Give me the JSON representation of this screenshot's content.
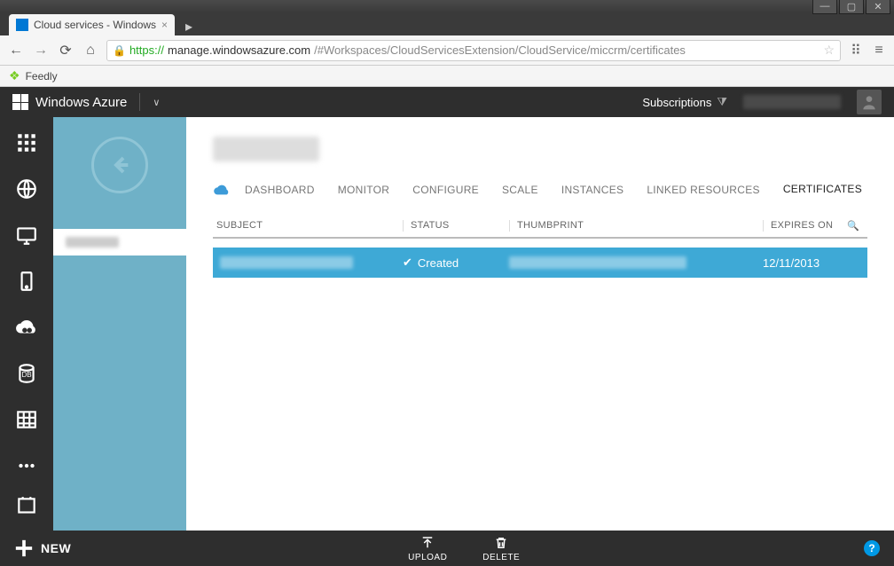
{
  "browser": {
    "tab_title": "Cloud services - Windows",
    "bookmark": "Feedly",
    "url_proto": "https://",
    "url_host": "manage.windowsazure.com",
    "url_path": "/#Workspaces/CloudServicesExtension/CloudService/miccrm/certificates"
  },
  "header": {
    "brand": "Windows Azure",
    "subscriptions_label": "Subscriptions"
  },
  "tabs": {
    "dashboard": "DASHBOARD",
    "monitor": "MONITOR",
    "configure": "CONFIGURE",
    "scale": "SCALE",
    "instances": "INSTANCES",
    "linked": "LINKED RESOURCES",
    "certificates": "CERTIFICATES"
  },
  "table": {
    "headers": {
      "subject": "SUBJECT",
      "status": "STATUS",
      "thumbprint": "THUMBPRINT",
      "expires": "EXPIRES ON"
    },
    "row": {
      "status": "Created",
      "expires": "12/11/2013"
    }
  },
  "commands": {
    "new": "NEW",
    "upload": "UPLOAD",
    "delete": "DELETE"
  }
}
